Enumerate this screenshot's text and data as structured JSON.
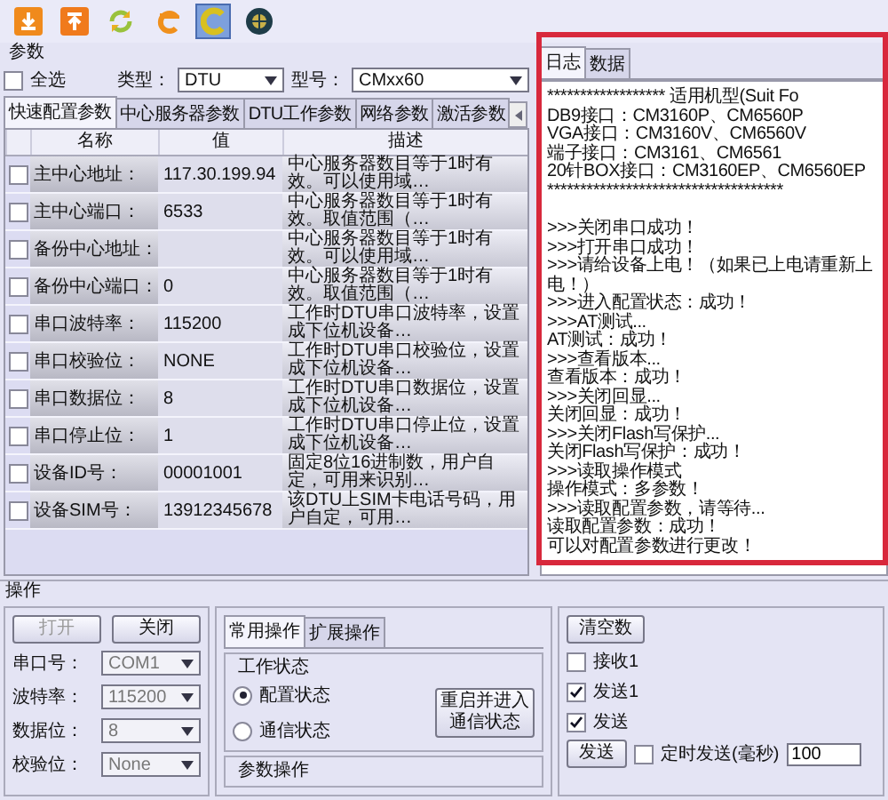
{
  "toolbar": {
    "buttons": [
      {
        "kind": "download",
        "selected": false
      },
      {
        "kind": "upload",
        "selected": false
      },
      {
        "kind": "refresh",
        "selected": false
      },
      {
        "kind": "e-letter",
        "selected": false
      },
      {
        "kind": "c-letter",
        "selected": true
      },
      {
        "kind": "globe",
        "selected": false
      }
    ]
  },
  "params": {
    "title": "参数",
    "select_all": {
      "label": "全选",
      "checked": false
    },
    "type": {
      "label": "类型：",
      "value": "DTU"
    },
    "model": {
      "label": "型号：",
      "value": "CMxx60"
    },
    "tabs": [
      {
        "label": "快速配置参数",
        "selected": true
      },
      {
        "label": "中心服务器参数",
        "selected": false
      },
      {
        "label": "DTU工作参数",
        "selected": false
      },
      {
        "label": "网络参数",
        "selected": false
      },
      {
        "label": "激活参数",
        "selected": false
      }
    ],
    "columns": [
      "名称",
      "值",
      "描述"
    ],
    "rows": [
      {
        "checked": false,
        "name": "主中心地址：",
        "value": "117.30.199.94",
        "description": "中心服务器数目等于1时有效。可以使用域…"
      },
      {
        "checked": false,
        "name": "主中心端口：",
        "value": "6533",
        "description": "中心服务器数目等于1时有效。取值范围（…"
      },
      {
        "checked": false,
        "name": "备份中心地址：",
        "description": "中心服务器数目等于1时有效。可以使用域…"
      },
      {
        "checked": false,
        "name": "备份中心端口：",
        "value": "0",
        "description": "中心服务器数目等于1时有效。取值范围（…"
      },
      {
        "checked": false,
        "name": "串口波特率：",
        "value": "115200",
        "description": "工作时DTU串口波特率，设置成下位机设备…"
      },
      {
        "checked": false,
        "name": "串口校验位：",
        "value": "NONE",
        "description": "工作时DTU串口校验位，设置成下位机设备…"
      },
      {
        "checked": false,
        "name": "串口数据位：",
        "value": "8",
        "description": "工作时DTU串口数据位，设置成下位机设备…"
      },
      {
        "checked": false,
        "name": "串口停止位：",
        "value": "1",
        "description": "工作时DTU串口停止位，设置成下位机设备…"
      },
      {
        "checked": false,
        "name": "设备ID号：",
        "value": "00001001",
        "description": "固定8位16进制数，用户自定，可用来识别…"
      },
      {
        "checked": false,
        "name": "设备SIM号：",
        "value": "13912345678",
        "description": "该DTU上SIM卡电话号码，用户自定，可用…"
      }
    ]
  },
  "log": {
    "tabs": [
      {
        "label": "日志",
        "selected": true
      },
      {
        "label": "数据",
        "selected": false
      }
    ],
    "header_lines": [
      "****************** 适用机型(Suit Fo",
      "DB9接口：CM3160P、CM6560P",
      "VGA接口：CM3160V、CM6560V",
      "端子接口：CM3161、CM6561",
      "20针BOX接口：CM3160EP、CM6560EP",
      "************************************"
    ],
    "lines": [
      ">>>关闭串口成功！",
      ">>>打开串口成功！",
      ">>>请给设备上电！（如果已上电请重新上电！）",
      ">>>进入配置状态：成功！",
      ">>>AT测试...",
      "AT测试：成功！",
      ">>>查看版本...",
      "查看版本：成功！",
      ">>>关闭回显...",
      "关闭回显：成功！",
      ">>>关闭Flash写保护...",
      "关闭Flash写保护：成功！",
      ">>>读取操作模式",
      "操作模式：多参数！",
      ">>>读取配置参数，请等待...",
      "读取配置参数：成功！",
      "可以对配置参数进行更改！"
    ]
  },
  "operation": {
    "title": "操作",
    "serial": {
      "buttons": [
        {
          "label": "打开",
          "disabled": true
        },
        {
          "label": "关闭",
          "disabled": false
        }
      ],
      "fields": [
        {
          "label": "串口号：",
          "value": "COM1"
        },
        {
          "label": "波特率：",
          "value": "115200"
        },
        {
          "label": "数据位：",
          "value": "8"
        },
        {
          "label": "校验位：",
          "value": "None"
        }
      ]
    },
    "tabs": [
      {
        "label": "常用操作",
        "selected": true
      },
      {
        "label": "扩展操作",
        "selected": false
      }
    ],
    "work_state": {
      "title": "工作状态",
      "options": [
        {
          "label": "配置状态",
          "selected": true
        },
        {
          "label": "通信状态",
          "selected": false
        }
      ],
      "button": "重启并进入通信状态"
    },
    "param_ops": {
      "title": "参数操作"
    },
    "send": {
      "clear_button": "清空数",
      "checks": [
        {
          "label": "接收1",
          "checked": false
        },
        {
          "label": "发送1",
          "checked": true
        },
        {
          "label": "发送",
          "checked": true
        }
      ],
      "send_button": "发送",
      "timer": {
        "label": "定时发送(毫秒)",
        "checked": false
      },
      "interval": "100"
    }
  }
}
